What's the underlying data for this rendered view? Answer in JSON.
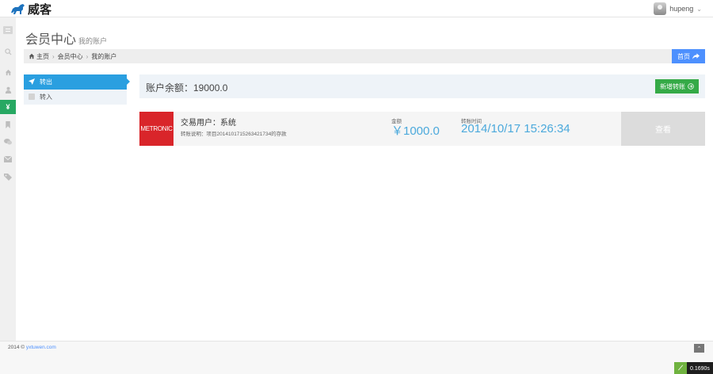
{
  "header": {
    "logo_text": "威客",
    "user_name": "hupeng",
    "user_chevron": "chevron-down-icon"
  },
  "sidebar": {
    "items": [
      {
        "icon": "menu-toggle-icon"
      },
      {
        "icon": "search-icon"
      },
      {
        "icon": "home-icon"
      },
      {
        "icon": "user-icon"
      },
      {
        "icon": "yen-icon",
        "glyph": "¥",
        "active": true
      },
      {
        "icon": "bookmark-icon"
      },
      {
        "icon": "comments-icon"
      },
      {
        "icon": "envelope-icon"
      },
      {
        "icon": "tags-icon"
      }
    ],
    "active_color": "#27a862"
  },
  "page": {
    "title": "会员中心",
    "subtitle": "我的账户"
  },
  "breadcrumb": {
    "items": [
      "主页",
      "会员中心",
      "我的账户"
    ],
    "homepage_button": "首页"
  },
  "tabs": [
    {
      "label": "转出",
      "icon": "rocket-icon",
      "active": true
    },
    {
      "label": "转入",
      "icon": "checkbox-icon",
      "active": false
    }
  ],
  "balance": {
    "label": "账户余额：19000.0",
    "add_button": "新增转账"
  },
  "transaction": {
    "logo_text": "METRONIC",
    "user": "交易用户：系统",
    "description": "转账说明：项目2014101715263421734的存款",
    "amount_label": "金额",
    "amount": "￥1000.0",
    "time_label": "转账时间",
    "time": "2014/10/17 15:26:34",
    "view_button": "查看"
  },
  "footer": {
    "copyright_prefix": "2014 ©",
    "copyright_link": "yxtuwen.com",
    "timer": "0.1690s"
  },
  "colors": {
    "primary_blue": "#4d90fe",
    "tab_active": "#2a9fe0",
    "success_green": "#35aa47",
    "brand_red": "#d9252a",
    "value_blue": "#4ba9dc"
  }
}
